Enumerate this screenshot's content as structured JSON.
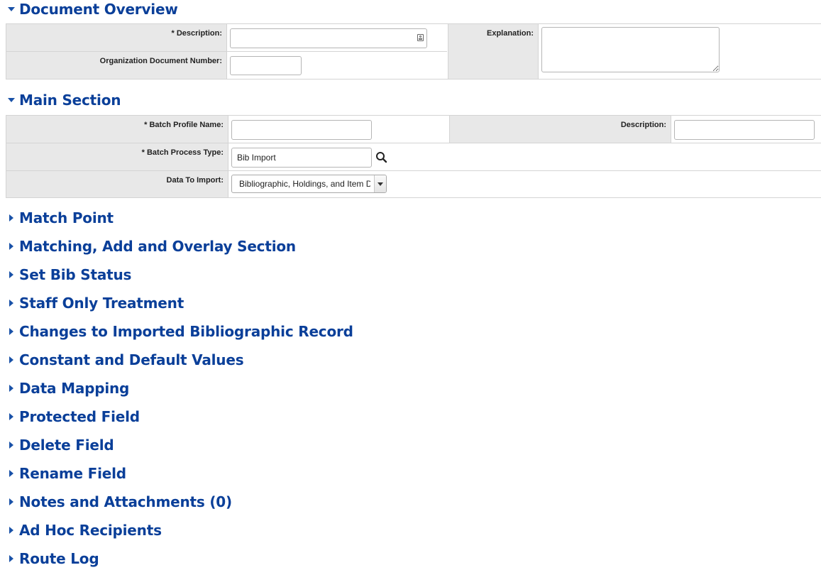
{
  "sections": {
    "document_overview": {
      "title": "Document Overview",
      "description_label": "* Description:",
      "description_value": "",
      "org_doc_number_label": "Organization Document Number:",
      "org_doc_number_value": "",
      "explanation_label": "Explanation:",
      "explanation_value": ""
    },
    "main_section": {
      "title": "Main Section",
      "batch_profile_name_label": "* Batch Profile Name:",
      "batch_profile_name_value": "",
      "description_label": "Description:",
      "description_value": "",
      "batch_process_type_label": "* Batch Process Type:",
      "batch_process_type_value": "Bib Import",
      "data_to_import_label": "Data To Import:",
      "data_to_import_value": "Bibliographic, Holdings, and Item Data"
    },
    "collapsed": [
      "Match Point",
      "Matching, Add and Overlay Section",
      "Set Bib Status",
      "Staff Only Treatment",
      "Changes to Imported Bibliographic Record",
      "Constant and Default Values",
      "Data Mapping",
      "Protected Field",
      "Delete Field",
      "Rename Field",
      "Notes and Attachments (0)",
      "Ad Hoc Recipients",
      "Route Log"
    ]
  },
  "colors": {
    "section_title": "#0a3f99",
    "label_background": "#e8e8e8",
    "border": "#d4d4d4"
  },
  "icons": {
    "expanded": "triangle-down-icon",
    "collapsed": "triangle-right-icon",
    "lookup": "search-icon",
    "description_field": "contact-card-icon"
  }
}
